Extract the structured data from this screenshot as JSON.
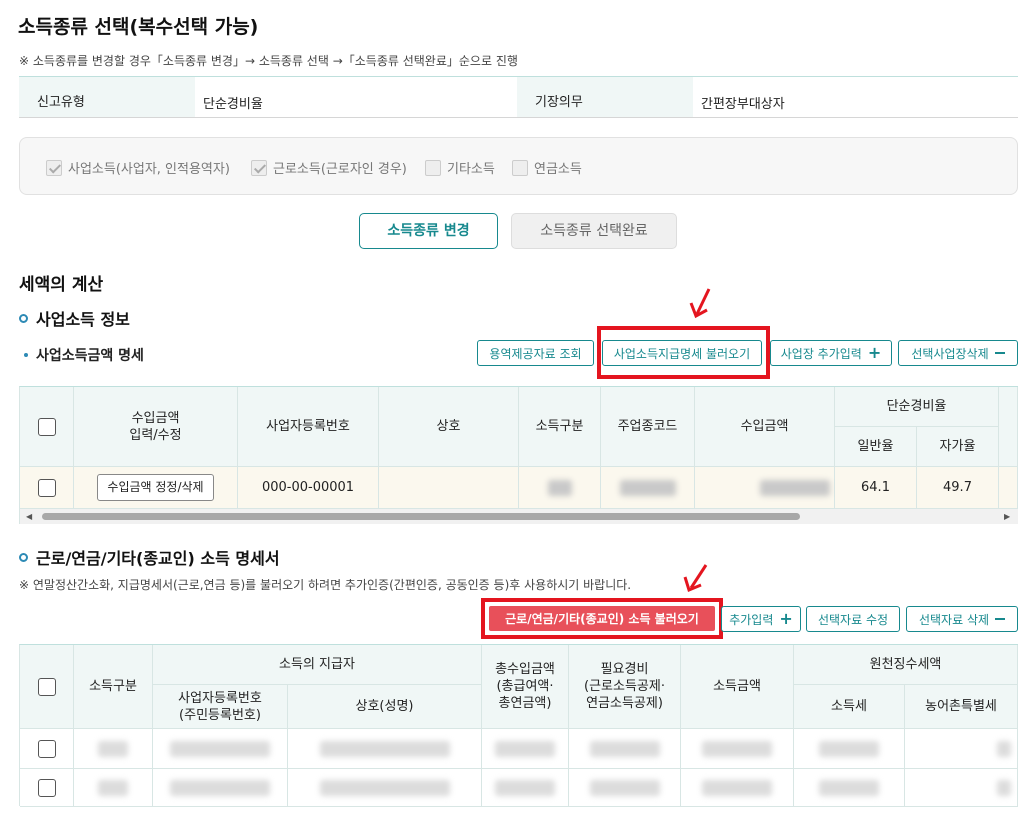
{
  "page": {
    "title": "소득종류 선택(복수선택 가능)",
    "notice": "※ 소득종류를 변경할 경우「소득종류 변경」→ 소득종류 선택 →「소득종류 선택완료」순으로 진행"
  },
  "info": {
    "report_type_label": "신고유형",
    "report_type_value": "단순경비율",
    "bookkeeping_label": "기장의무",
    "bookkeeping_value": "간편장부대상자"
  },
  "income_types": [
    {
      "label": "사업소득(사업자, 인적용역자)",
      "checked": true
    },
    {
      "label": "근로소득(근로자인 경우)",
      "checked": true
    },
    {
      "label": "기타소득",
      "checked": false
    },
    {
      "label": "연금소득",
      "checked": false
    }
  ],
  "buttons": {
    "change": "소득종류 변경",
    "complete": "소득종류 선택완료"
  },
  "tax_calc": {
    "title": "세액의 계산",
    "business": {
      "title": "사업소득 정보",
      "subtitle": "사업소득금액 명세",
      "btn_service": "용역제공자료 조회",
      "btn_load": "사업소득지급명세 불러오기",
      "btn_add": "사업장 추가입력",
      "btn_delete": "선택사업장삭제",
      "headers": {
        "income_edit": "수입금액\n입력/수정",
        "reg_no": "사업자등록번호",
        "name": "상호",
        "income_class": "소득구분",
        "industry_code": "주업종코드",
        "revenue": "수입금액",
        "simple_rate": "단순경비율",
        "general_rate": "일반율",
        "own_rate": "자가율"
      },
      "rows": [
        {
          "edit_btn": "수입금액 정정/삭제",
          "reg_no": "000-00-00001",
          "general_rate": "64.1",
          "own_rate": "49.7"
        }
      ]
    },
    "other": {
      "title": "근로/연금/기타(종교인) 소득 명세서",
      "notice": "※ 연말정산간소화, 지급명세서(근로,연금 등)를 불러오기 하려면 추가인증(간편인증, 공동인증 등)후 사용하시기 바랍니다.",
      "btn_load": "근로/연금/기타(종교인) 소득 불러오기",
      "btn_add": "추가입력",
      "btn_edit": "선택자료 수정",
      "btn_delete": "선택자료 삭제",
      "headers": {
        "income_class": "소득구분",
        "payer": "소득의 지급자",
        "reg_no": "사업자등록번호\n(주민등록번호)",
        "name": "상호(성명)",
        "total_income": "총수입금액\n(총급여액·\n총연금액)",
        "expenses": "필요경비\n(근로소득공제·\n연금소득공제)",
        "income_amount": "소득금액",
        "withholding": "원천징수세액",
        "income_tax": "소득세",
        "rural_tax": "농어촌특별세"
      }
    }
  },
  "colors": {
    "accent": "#17898e",
    "highlight": "#e4151f",
    "header_bg": "#f0f7f6"
  }
}
